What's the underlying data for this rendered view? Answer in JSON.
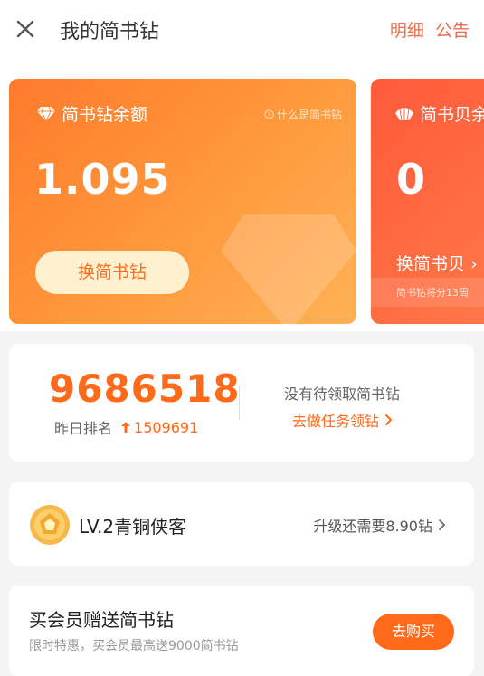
{
  "header": {
    "title": "我的简书钻",
    "detail_link": "明细",
    "notice_link": "公告"
  },
  "diamond_card": {
    "label": "简书钻余额",
    "help": "什么是简书钻",
    "amount": "1.095",
    "button": "换简书钻"
  },
  "shell_card": {
    "label": "简书贝余",
    "amount": "0",
    "link": "换简书贝",
    "note": "简书钻将分13周"
  },
  "rank": {
    "number": "9686518",
    "label": "昨日排名",
    "change": "1509691",
    "pending_text": "没有待领取简书钻",
    "task_link": "去做任务领钻"
  },
  "level": {
    "name": "LV.2青铜侠客",
    "upgrade_text": "升级还需要8.90钻"
  },
  "vip": {
    "title": "买会员赠送简书钻",
    "subtitle": "限时特惠，买会员最高送9000简书钻",
    "button": "去购买"
  },
  "colors": {
    "accent": "#ff6a1a",
    "header_link": "#ef6b4f",
    "diamond_card_start": "#ff7a2b",
    "diamond_card_end": "#ffb155",
    "shell_card": "#ff5a3a"
  }
}
